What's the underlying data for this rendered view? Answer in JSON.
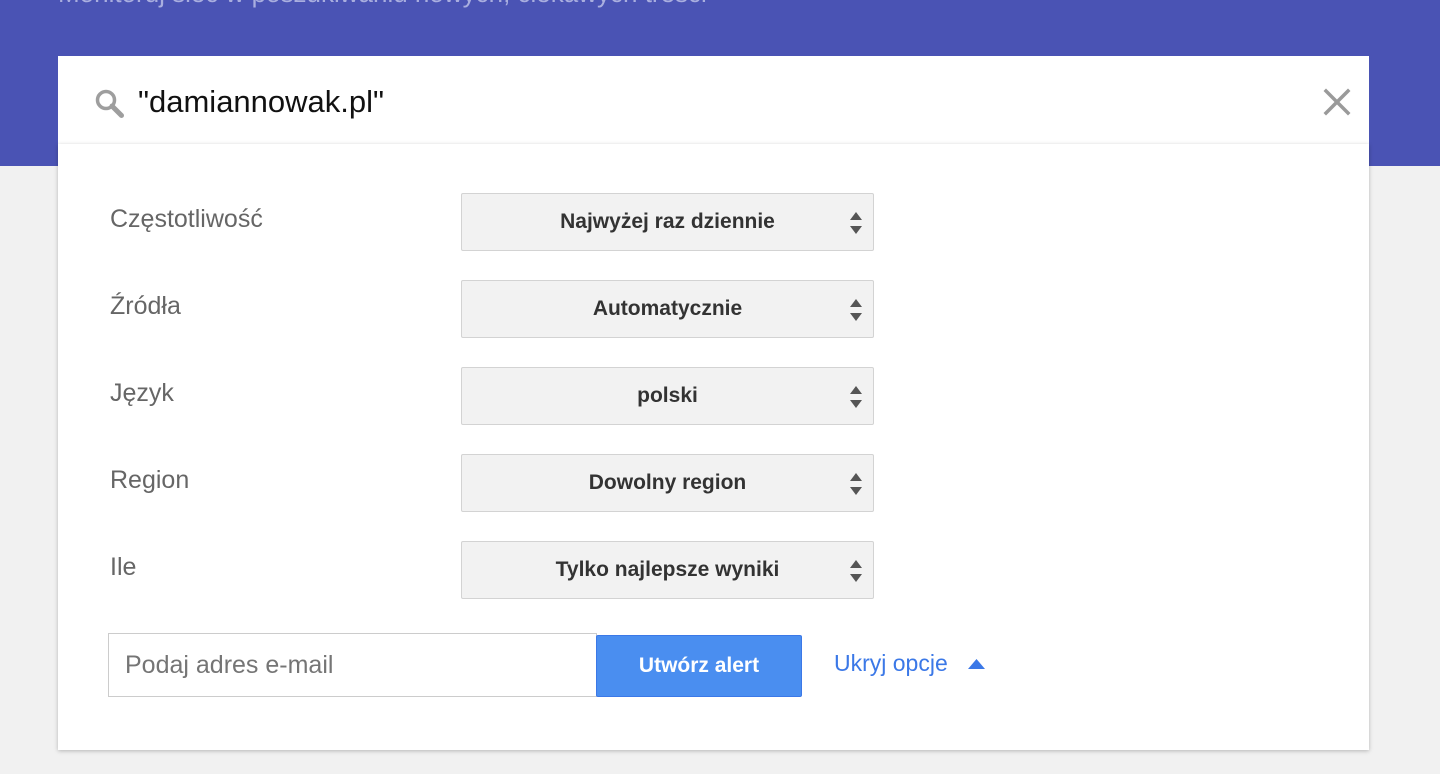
{
  "header": {
    "tagline": "Monitoruj sieć w poszukiwaniu nowych, ciekawych treści"
  },
  "search": {
    "query": "\"damiannowak.pl\"",
    "search_icon": "search-icon",
    "clear_icon": "close-icon"
  },
  "options": [
    {
      "label": "Częstotliwość",
      "value": "Najwyżej raz dziennie"
    },
    {
      "label": "Źródła",
      "value": "Automatycznie"
    },
    {
      "label": "Język",
      "value": "polski"
    },
    {
      "label": "Region",
      "value": "Dowolny region"
    },
    {
      "label": "Ile",
      "value": "Tylko najlepsze wyniki"
    }
  ],
  "actions": {
    "email_placeholder": "Podaj adres e-mail",
    "email_value": "",
    "create_button_label": "Utwórz alert",
    "hide_options_label": "Ukryj opcje",
    "hide_options_icon": "caret-up-icon"
  },
  "colors": {
    "header_background": "#4a53b4",
    "primary_button": "#4a8ef0",
    "link": "#3b78e7",
    "page_background": "#f1f1f1"
  }
}
